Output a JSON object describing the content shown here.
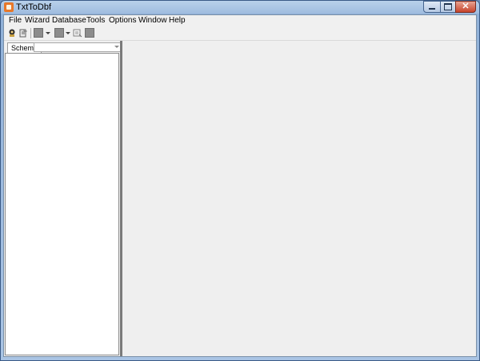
{
  "window": {
    "title": "TxtToDbf"
  },
  "menubar": {
    "items": [
      "File",
      "Wizard",
      "Database",
      "Tools",
      "Options",
      "Window",
      "Help"
    ]
  },
  "toolbar": {
    "icons": [
      "wizard-icon",
      "edit-icon",
      "disabled-icon",
      "disabled-icon",
      "disabled-icon",
      "preview-icon",
      "disabled-icon"
    ]
  },
  "leftpanel": {
    "tab_label": "Schema",
    "schema_value": ""
  }
}
